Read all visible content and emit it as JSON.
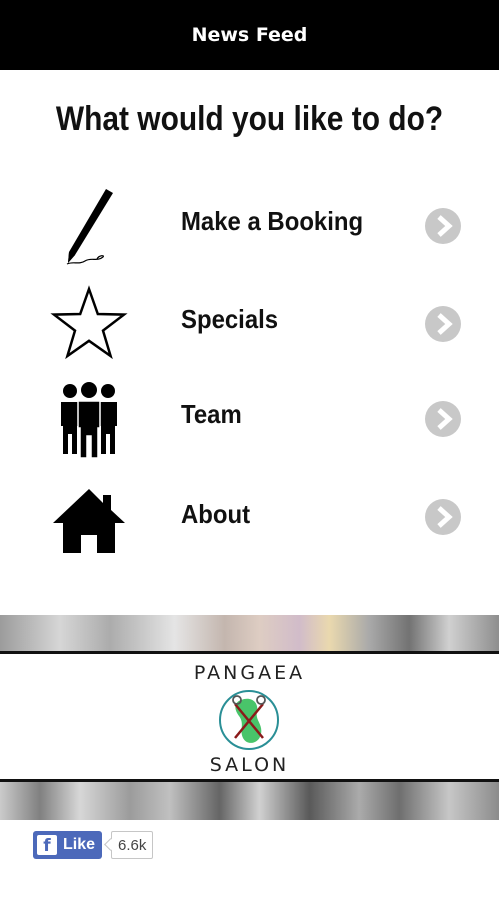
{
  "header": {
    "title": "News Feed"
  },
  "main": {
    "heading": "What would you like to do?",
    "menu": [
      {
        "label": "Make a Booking",
        "icon": "pen-icon"
      },
      {
        "label": "Specials",
        "icon": "star-icon"
      },
      {
        "label": "Team",
        "icon": "people-icon"
      },
      {
        "label": "About",
        "icon": "home-icon"
      }
    ]
  },
  "banner": {
    "logo_top": "PANGAEA",
    "logo_bottom": "SALON"
  },
  "facebook": {
    "like_label": "Like",
    "count": "6.6k"
  },
  "colors": {
    "topbar": "#000000",
    "chevron": "#c8c8c8",
    "facebook": "#4c69ba",
    "logo_green": "#49c46a",
    "logo_ring": "#2a8f96",
    "logo_x": "#8b1a1a"
  }
}
